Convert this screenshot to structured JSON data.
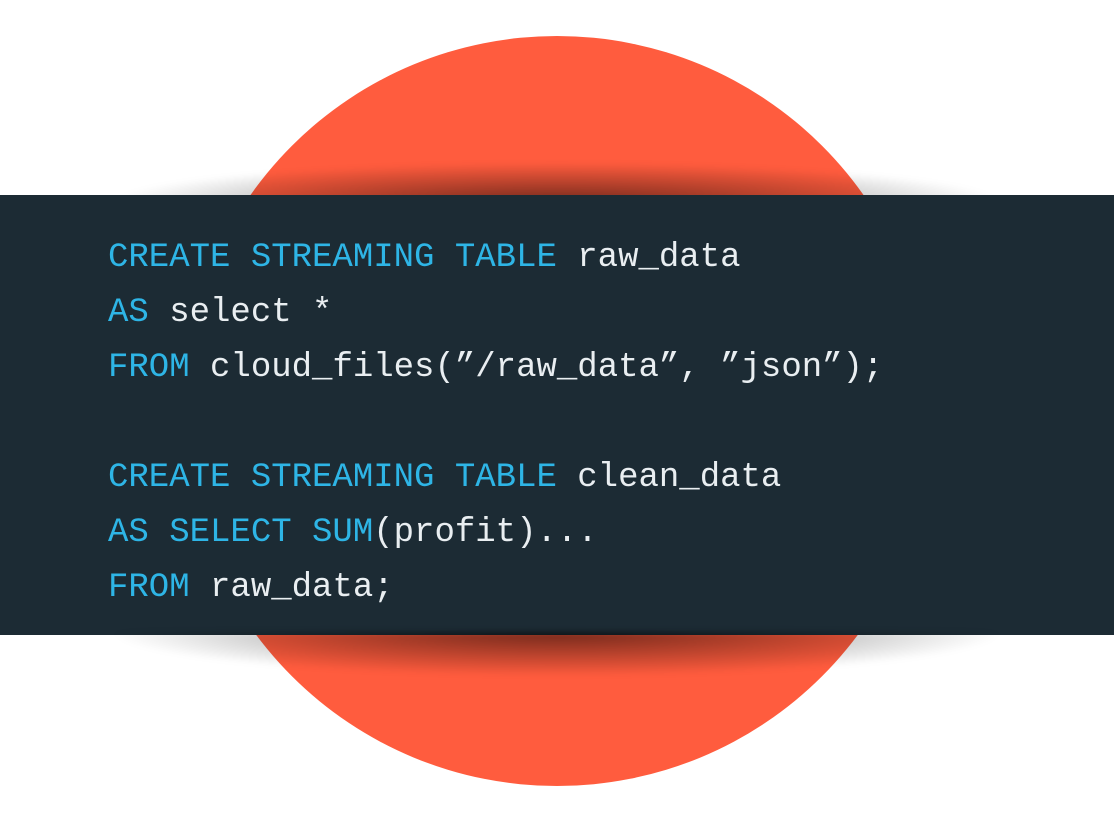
{
  "colors": {
    "circle": "#ff5c3e",
    "panel_bg": "#1c2b34",
    "keyword": "#2eb5e6",
    "text": "#e9eef1"
  },
  "code": {
    "line1": {
      "kw1": "CREATE STREAMING TABLE",
      "rest": " raw_data "
    },
    "line2": {
      "kw1": "AS",
      "rest": " select * "
    },
    "line3": {
      "kw1": "FROM",
      "rest": " cloud_files(”/raw_data”, ”json”);"
    },
    "blank": "",
    "line4": {
      "kw1": "CREATE STREAMING TABLE",
      "rest": " clean_data "
    },
    "line5": {
      "kw1": "AS SELECT SUM",
      "rest": "(profit)... "
    },
    "line6": {
      "kw1": "FROM",
      "rest": " raw_data;"
    }
  }
}
